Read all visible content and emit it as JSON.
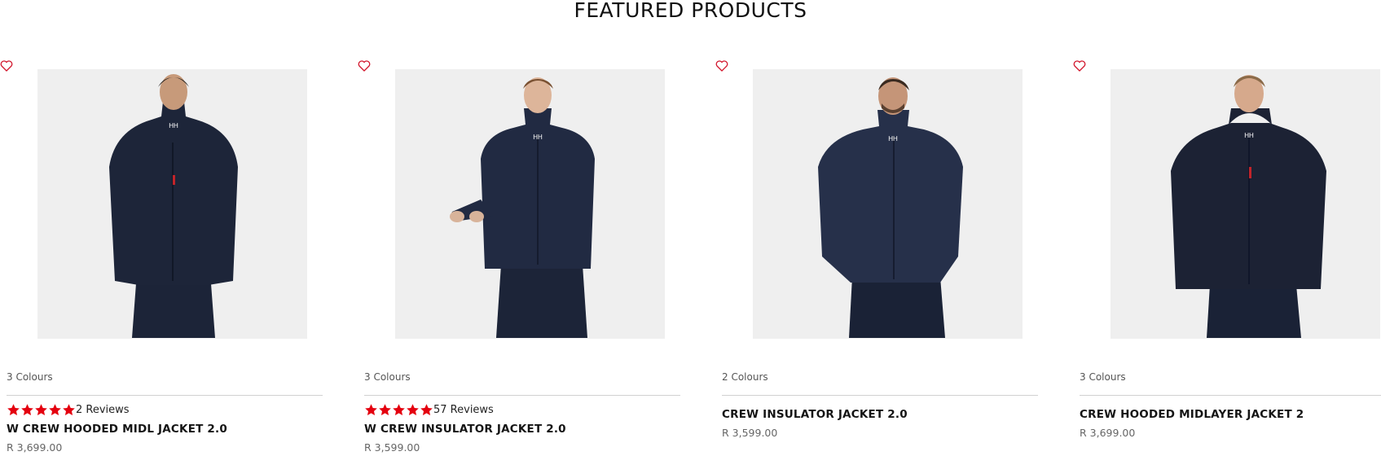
{
  "section": {
    "title": "FEATURED PRODUCTS"
  },
  "colors": {
    "star": "#e4000f",
    "heart": "#d2162c",
    "image_bg": "#efefef",
    "jacket": "#1c2438"
  },
  "products": [
    {
      "colours": "3 Colours",
      "rating_stars": 5,
      "reviews": "2 Reviews",
      "name": "W CREW HOODED MIDL JACKET 2.0",
      "price": "R 3,699.00"
    },
    {
      "colours": "3 Colours",
      "rating_stars": 5,
      "reviews": "57 Reviews",
      "name": "W CREW INSULATOR JACKET 2.0",
      "price": "R 3,599.00"
    },
    {
      "colours": "2 Colours",
      "name": "CREW INSULATOR JACKET 2.0",
      "price": "R 3,599.00"
    },
    {
      "colours": "3 Colours",
      "name": "CREW HOODED MIDLAYER JACKET 2",
      "price": "R 3,699.00"
    }
  ]
}
